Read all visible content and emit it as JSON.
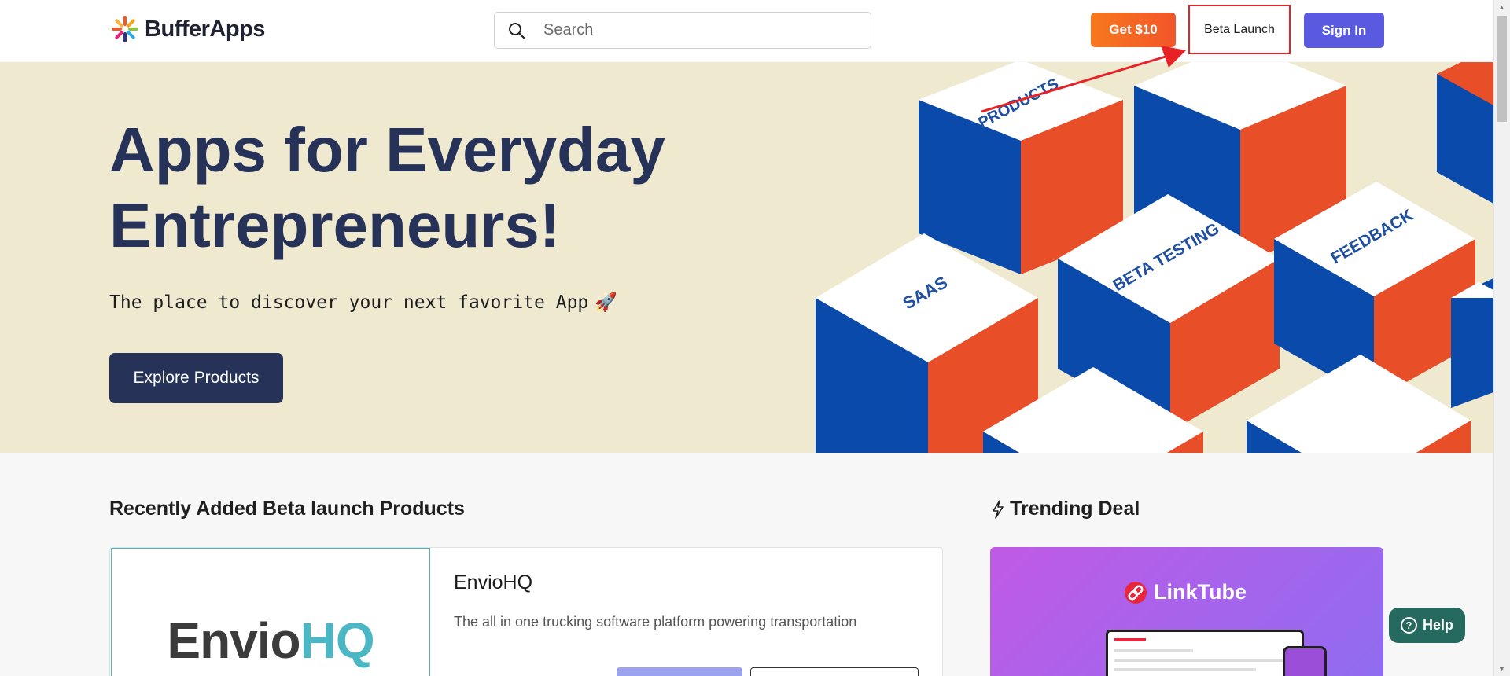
{
  "header": {
    "brand": "BufferApps",
    "search_placeholder": "Search",
    "get_label": "Get $10",
    "beta_label": "Beta Launch",
    "signin_label": "Sign In"
  },
  "hero": {
    "title_line1": "Apps for Everyday",
    "title_line2": "Entrepreneurs!",
    "subtitle": "The place to discover your next favorite App",
    "rocket": "🚀",
    "explore_label": "Explore Products",
    "cube_labels": [
      "PRODUCTS",
      "SAAS",
      "BETA TESTING",
      "FEEDBACK"
    ]
  },
  "recent": {
    "title": "Recently Added Beta launch Products",
    "product": {
      "logo_left": "Envio",
      "logo_right": "HQ",
      "name": "EnvioHQ",
      "description": "The all in one trucking software platform powering transportation"
    }
  },
  "trending": {
    "title": "Trending Deal",
    "deal_name": "LinkTube"
  },
  "help": {
    "label": "Help"
  },
  "colors": {
    "navy": "#263258",
    "hero_bg": "#efe9d0",
    "cube_blue": "#0a4aab",
    "cube_orange": "#e84e28",
    "accent_purple": "#5a5ae0",
    "annotation_red": "#e82127"
  }
}
